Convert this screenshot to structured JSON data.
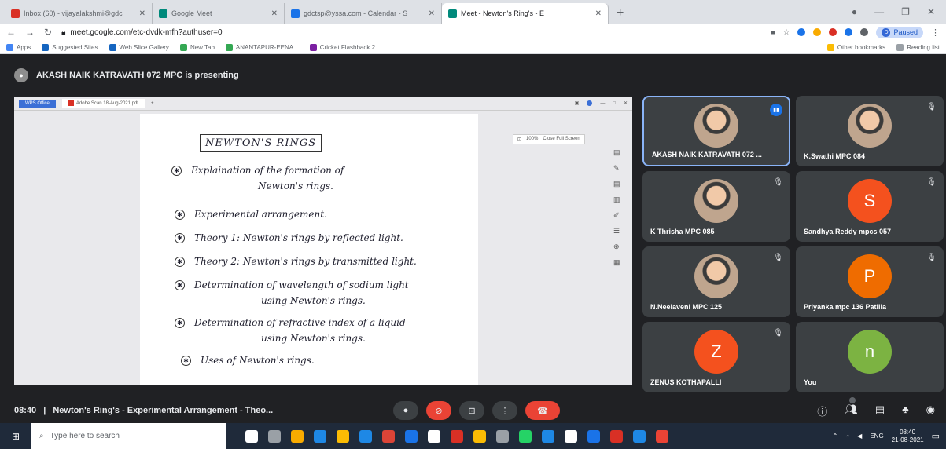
{
  "browser": {
    "tabs": [
      {
        "title": "Inbox (60) - vijayalakshmi@gdc",
        "color": "#d93025",
        "active": false
      },
      {
        "title": "Google Meet",
        "color": "#00897b",
        "active": false
      },
      {
        "title": "gdctsp@yssa.com - Calendar - S",
        "color": "#1a73e8",
        "active": false
      },
      {
        "title": "Meet - Newton's Ring's - E",
        "color": "#00897b",
        "active": true
      }
    ],
    "new_tab": "+",
    "url": "meet.google.com/etc-dvdk-mfh?authuser=0",
    "profile_initial": "D",
    "profile_status": "Paused",
    "bookmarks": [
      {
        "label": "Apps",
        "color": "#4285f4"
      },
      {
        "label": "Suggested Sites",
        "color": "#1565c0"
      },
      {
        "label": "Web Slice Gallery",
        "color": "#1565c0"
      },
      {
        "label": "New Tab",
        "color": "#34a853"
      },
      {
        "label": "ANANTAPUR-EENA...",
        "color": "#34a853"
      },
      {
        "label": "Cricket Flashback 2...",
        "color": "#7b1fa2"
      }
    ],
    "other_bookmarks": "Other bookmarks",
    "reading_list": "Reading list"
  },
  "meet": {
    "presenting_text": "AKASH NAIK KATRAVATH 072 MPC is presenting",
    "shared_screen": {
      "app_tab": "WPS Office",
      "doc_tab": "Adobe Scan 18-Aug-2021.pdf",
      "zoom": "100%",
      "exit_fullscreen": "Close Full Screen",
      "page_title": "NEWTON'S RINGS",
      "bullets": [
        {
          "text": "Explaination of the formation of",
          "cont": "Newton's rings."
        },
        {
          "text": "Experimental arrangement.",
          "cont": ""
        },
        {
          "text": "Theory 1: Newton's rings by reflected light.",
          "cont": ""
        },
        {
          "text": "Theory 2: Newton's rings by transmitted light.",
          "cont": ""
        },
        {
          "text": "Determination of wavelength of sodium light",
          "cont": "using Newton's rings."
        },
        {
          "text": "Determination of refractive index of a liquid",
          "cont": "using Newton's rings."
        },
        {
          "text": "Uses of Newton's rings.",
          "cont": ""
        }
      ]
    },
    "participants": [
      {
        "name": "AKASH NAIK KATRAVATH 072 ...",
        "initial": "",
        "color": "",
        "photo": true,
        "speaking": true
      },
      {
        "name": "K.Swathi MPC 084",
        "initial": "",
        "color": "",
        "photo": true,
        "speaking": false
      },
      {
        "name": "K Thrisha MPC 085",
        "initial": "",
        "color": "",
        "photo": true,
        "speaking": false
      },
      {
        "name": "Sandhya Reddy mpcs 057",
        "initial": "S",
        "color": "#f4511e",
        "photo": false,
        "speaking": false
      },
      {
        "name": "N.Neelaveni MPC 125",
        "initial": "",
        "color": "",
        "photo": true,
        "speaking": false
      },
      {
        "name": "Priyanka mpc 136 Patilla",
        "initial": "P",
        "color": "#ef6c00",
        "photo": false,
        "speaking": false
      },
      {
        "name": "ZENUS KOTHAPALLI",
        "initial": "Z",
        "color": "#f4511e",
        "photo": false,
        "speaking": false
      },
      {
        "name": "You",
        "initial": "n",
        "color": "#7cb342",
        "photo": false,
        "speaking": false
      }
    ],
    "time": "08:40",
    "meeting_title": "Newton's Ring's - Experimental Arrangement - Theo..."
  },
  "taskbar": {
    "search_placeholder": "Type here to search",
    "language": "ENG",
    "clock_time": "08:40",
    "clock_date": "21-08-2021",
    "app_colors": [
      "#ffffff",
      "#9aa0a6",
      "#f9ab00",
      "#1e88e5",
      "#fbbc04",
      "#1e88e5",
      "#db4437",
      "#1a73e8",
      "#ffffff",
      "#d93025",
      "#fbbc04",
      "#9aa0a6",
      "#25d366",
      "#1e88e5",
      "#ffffff",
      "#1a73e8",
      "#d93025",
      "#1e88e5",
      "#ea4335"
    ]
  }
}
